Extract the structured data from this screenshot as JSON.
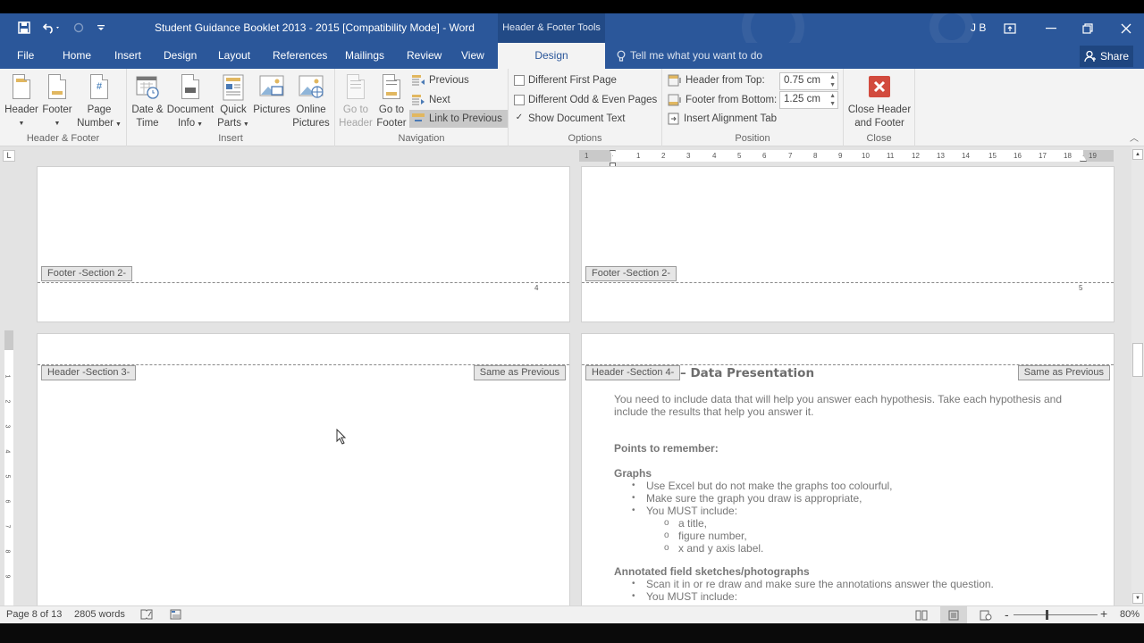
{
  "titlebar": {
    "title": "Student Guidance Booklet 2013 - 2015 [Compatibility Mode] - Word",
    "context_tab_group": "Header & Footer Tools",
    "user_initials": "J B",
    "save_icon": "save-icon",
    "undo_icon": "undo-icon",
    "redo_icon": "redo-icon",
    "customize_icon": "customize-quick-access-icon"
  },
  "tabs": [
    {
      "label": "File"
    },
    {
      "label": "Home"
    },
    {
      "label": "Insert"
    },
    {
      "label": "Design"
    },
    {
      "label": "Layout"
    },
    {
      "label": "References"
    },
    {
      "label": "Mailings"
    },
    {
      "label": "Review"
    },
    {
      "label": "View"
    },
    {
      "label": "Design",
      "active": true
    }
  ],
  "tellme": {
    "placeholder": "Tell me what you want to do"
  },
  "share": {
    "label": "Share"
  },
  "ribbon": {
    "header_footer_group": {
      "label": "Header & Footer",
      "header": "Header",
      "footer": "Footer",
      "page_number_1": "Page",
      "page_number_2": "Number"
    },
    "insert_group": {
      "label": "Insert",
      "date_time_1": "Date &",
      "date_time_2": "Time",
      "document_info_1": "Document",
      "document_info_2": "Info",
      "quick_parts_1": "Quick",
      "quick_parts_2": "Parts",
      "pictures": "Pictures",
      "online_pictures_1": "Online",
      "online_pictures_2": "Pictures"
    },
    "navigation_group": {
      "label": "Navigation",
      "go_to_header_1": "Go to",
      "go_to_header_2": "Header",
      "go_to_footer_1": "Go to",
      "go_to_footer_2": "Footer",
      "previous": "Previous",
      "next": "Next",
      "link_to_previous": "Link to Previous"
    },
    "options_group": {
      "label": "Options",
      "different_first_page": "Different First Page",
      "different_first_page_checked": false,
      "different_odd_even": "Different Odd & Even Pages",
      "different_odd_even_checked": false,
      "show_document_text": "Show Document Text",
      "show_document_text_checked": true,
      "check_mark": "✓"
    },
    "position_group": {
      "label": "Position",
      "header_from_top_label": "Header from Top:",
      "header_from_top_value": "0.75 cm",
      "footer_from_bottom_label": "Footer from Bottom:",
      "footer_from_bottom_value": "1.25 cm",
      "insert_alignment_tab": "Insert Alignment Tab"
    },
    "close_group": {
      "label": "Close",
      "close_1": "Close Header",
      "close_2": "and Footer"
    }
  },
  "ruler": {
    "ticks": [
      "1",
      "1",
      "2",
      "3",
      "4",
      "5",
      "6",
      "7",
      "8",
      "9",
      "10",
      "11",
      "12",
      "13",
      "14",
      "15",
      "16",
      "17",
      "18",
      "19"
    ],
    "vticks": [
      "1",
      "2",
      "3",
      "4",
      "5",
      "6",
      "7",
      "8",
      "9"
    ],
    "tab_selector": "L"
  },
  "pages": {
    "top_left": {
      "footer_tag": "Footer -Section 2-",
      "page_number": "4"
    },
    "top_right": {
      "footer_tag": "Footer -Section 2-",
      "page_number": "5"
    },
    "bottom_left": {
      "header_tag": "Header -Section 3-",
      "same_as_previous": "Same as Previous"
    },
    "bottom_right": {
      "header_tag": "Header -Section 4-",
      "same_as_previous": "Same as Previous",
      "heading": "– Data Presentation",
      "intro_1": "You need to include data that will help you answer each hypothesis.  Take each hypothesis and",
      "intro_2": "include the results that help you answer it.",
      "points_heading": "Points to remember:",
      "graphs_heading": "Graphs",
      "graphs_items": [
        "Use Excel but do not make the graphs too colourful,",
        "Make sure the graph you draw is appropriate,",
        "You MUST include:"
      ],
      "graphs_sub_items": [
        " a title,",
        "figure number,",
        "x and y axis label."
      ],
      "annotated_heading": "Annotated field sketches/photographs",
      "annotated_items": [
        "Scan it in or re draw and make sure the annotations answer the question.",
        "You MUST include:"
      ],
      "bullet": "•",
      "sub_bullet": "o"
    }
  },
  "statusbar": {
    "page": "Page 8 of 13",
    "words": "2805 words",
    "zoom_percent": "80%",
    "zoom_minus": "-",
    "zoom_plus": "+",
    "zoom_level": 0.8
  }
}
